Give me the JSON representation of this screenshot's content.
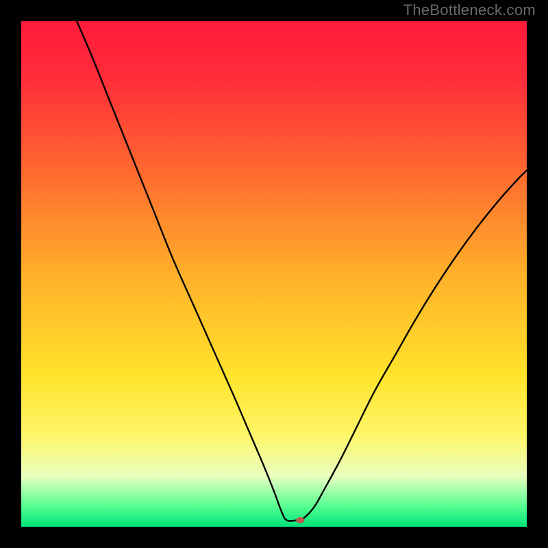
{
  "watermark": "TheBottleneck.com",
  "chart_data": {
    "type": "line",
    "title": "",
    "xlabel": "",
    "ylabel": "",
    "xlim": [
      0,
      100
    ],
    "ylim": [
      0,
      100
    ],
    "gradient_stops": [
      {
        "offset": 0.0,
        "color": "#ff1a3a"
      },
      {
        "offset": 0.12,
        "color": "#ff2f3a"
      },
      {
        "offset": 0.3,
        "color": "#ff6a2f"
      },
      {
        "offset": 0.5,
        "color": "#ffb02a"
      },
      {
        "offset": 0.7,
        "color": "#ffe32a"
      },
      {
        "offset": 0.82,
        "color": "#fff76a"
      },
      {
        "offset": 0.9,
        "color": "#e8ffc0"
      },
      {
        "offset": 0.96,
        "color": "#55ff90"
      },
      {
        "offset": 1.0,
        "color": "#00e37a"
      }
    ],
    "series": [
      {
        "name": "bottleneck-curve",
        "color": "#000000",
        "points": [
          {
            "x": 11.0,
            "y": 100.0
          },
          {
            "x": 14.0,
            "y": 93.0
          },
          {
            "x": 18.0,
            "y": 83.0
          },
          {
            "x": 22.0,
            "y": 73.0
          },
          {
            "x": 26.0,
            "y": 63.0
          },
          {
            "x": 30.0,
            "y": 53.0
          },
          {
            "x": 34.0,
            "y": 44.0
          },
          {
            "x": 38.0,
            "y": 35.0
          },
          {
            "x": 42.0,
            "y": 26.0
          },
          {
            "x": 45.0,
            "y": 19.0
          },
          {
            "x": 48.0,
            "y": 12.0
          },
          {
            "x": 50.0,
            "y": 7.0
          },
          {
            "x": 51.5,
            "y": 3.0
          },
          {
            "x": 52.5,
            "y": 1.3
          },
          {
            "x": 54.5,
            "y": 1.3
          },
          {
            "x": 56.0,
            "y": 1.8
          },
          {
            "x": 58.0,
            "y": 4.0
          },
          {
            "x": 60.0,
            "y": 7.5
          },
          {
            "x": 63.0,
            "y": 13.0
          },
          {
            "x": 66.0,
            "y": 19.0
          },
          {
            "x": 70.0,
            "y": 27.0
          },
          {
            "x": 74.0,
            "y": 34.0
          },
          {
            "x": 78.0,
            "y": 41.0
          },
          {
            "x": 82.0,
            "y": 47.5
          },
          {
            "x": 86.0,
            "y": 53.5
          },
          {
            "x": 90.0,
            "y": 59.0
          },
          {
            "x": 94.0,
            "y": 64.0
          },
          {
            "x": 98.0,
            "y": 68.5
          },
          {
            "x": 100.0,
            "y": 70.5
          }
        ]
      }
    ],
    "marker": {
      "name": "optimum-marker",
      "x": 55.2,
      "y": 1.3,
      "color": "#c0574a",
      "rx": 6,
      "ry": 4.5
    }
  }
}
